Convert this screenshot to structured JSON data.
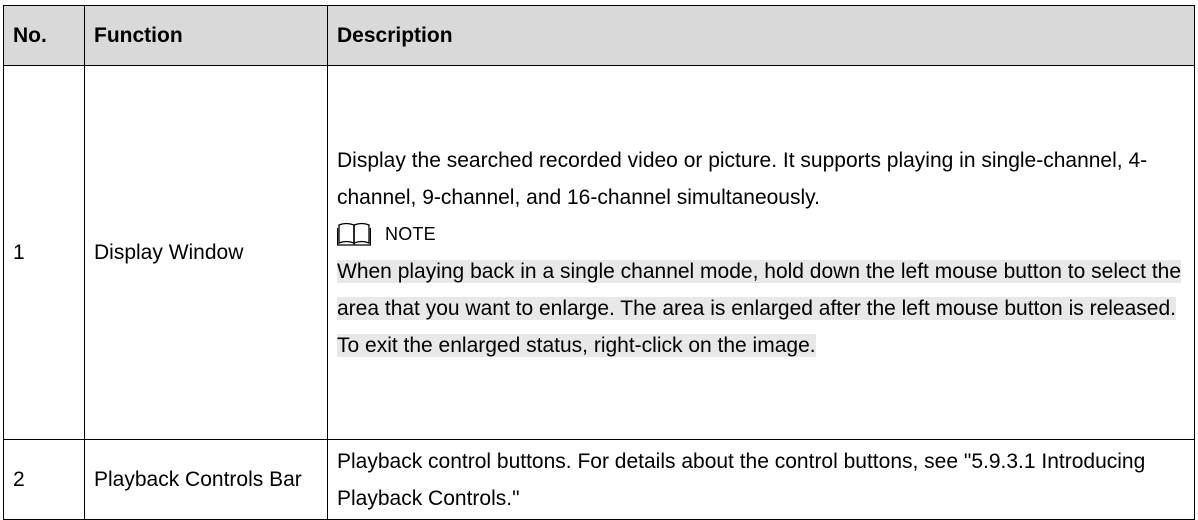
{
  "table": {
    "headers": [
      "No.",
      "Function",
      "Description"
    ],
    "rows": [
      {
        "no": "1",
        "function": "Display Window",
        "description": "Display the searched recorded video or picture. It supports playing in single-channel, 4-channel, 9-channel, and 16-channel simultaneously.",
        "note_label": "NOTE",
        "note_icon": "book-icon",
        "note_text": "When playing back in a single channel mode, hold down the left mouse button to select the area that you want to enlarge. The area is enlarged after the left mouse button is released. To exit the enlarged status, right-click on the image."
      },
      {
        "no": "2",
        "function": "Playback Controls Bar",
        "description": "Playback control buttons. For details about the control buttons, see \"5.9.3.1 Introducing Playback Controls.\""
      }
    ]
  },
  "colors": {
    "header_bg": "#d9d9d9",
    "note_highlight": "#e8e8e8",
    "border": "#000000"
  }
}
